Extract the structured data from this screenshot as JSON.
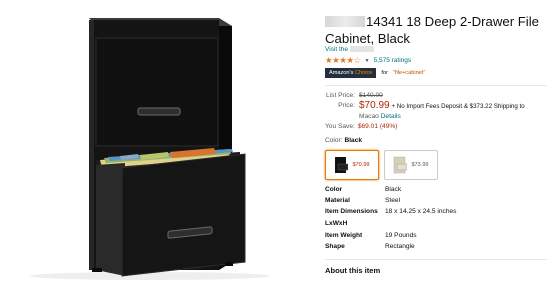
{
  "product": {
    "title": "14341 18 Deep 2-Drawer File Cabinet, Black",
    "visit_prefix": "Visit the",
    "ratings": "5,575 ratings",
    "stars": "★★★★☆",
    "badge_amazon": "Amazon's",
    "badge_choice": "Choice",
    "choice_for": "for",
    "choice_keyword": "\"file+cabinet\""
  },
  "pricing": {
    "list_label": "List Price:",
    "list_price": "$140.00",
    "price_label": "Price:",
    "price": "$70.99",
    "shipping_text": "+ No Import Fees Deposit & $373.22 Shipping to",
    "shipping_place": "Macao",
    "details_link": "Details",
    "save_label": "You Save:",
    "save_value": "$69.01 (49%)"
  },
  "color": {
    "label": "Color:",
    "selected": "Black",
    "options": [
      {
        "price": "$70.99",
        "swatch": "#111111"
      },
      {
        "price": "$73.99",
        "swatch": "#d8cfbc"
      }
    ]
  },
  "specs": [
    {
      "key": "Color",
      "value": "Black"
    },
    {
      "key": "Material",
      "value": "Steel"
    },
    {
      "key": "Item Dimensions LxWxH",
      "value": "18 x 14.25 x 24.5 inches"
    },
    {
      "key": "Item Weight",
      "value": "19 Pounds"
    },
    {
      "key": "Shape",
      "value": "Rectangle"
    }
  ],
  "about_heading": "About this item"
}
